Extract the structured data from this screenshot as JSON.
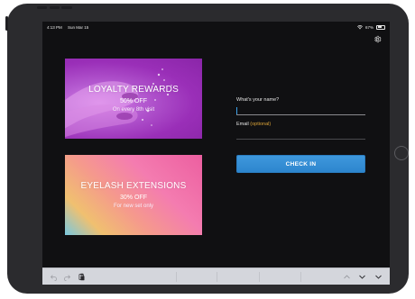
{
  "status_bar": {
    "time": "4:13 PM",
    "date": "Sun Mar 15",
    "battery": "67%",
    "battery_level": 0.67
  },
  "promotions": [
    {
      "title": "LOYALTY REWARDS",
      "subtitle": "50% OFF",
      "note": "On every 8th visit"
    },
    {
      "title": "EYELASH EXTENSIONS",
      "subtitle": "30% OFF",
      "note": "For new set only"
    }
  ],
  "form": {
    "name_label": "What's your name?",
    "name_value": "",
    "email_label": "Email",
    "email_optional": "(optional)",
    "email_value": "",
    "submit_label": "CHECK IN"
  },
  "icons": {
    "settings": "gear-icon",
    "keyboard_undo": "undo-icon",
    "keyboard_redo": "redo-icon",
    "keyboard_paste": "paste-icon",
    "keyboard_up": "chevron-up-icon",
    "keyboard_down": "chevron-down-icon",
    "keyboard_hide": "keyboard-dismiss-icon"
  },
  "colors": {
    "screen_background": "#101012",
    "accent_button": "#3a93d8",
    "optional_text": "#d9a237",
    "loyalty_card": "#9a2fb8",
    "lash_card": "#f47cb0"
  }
}
